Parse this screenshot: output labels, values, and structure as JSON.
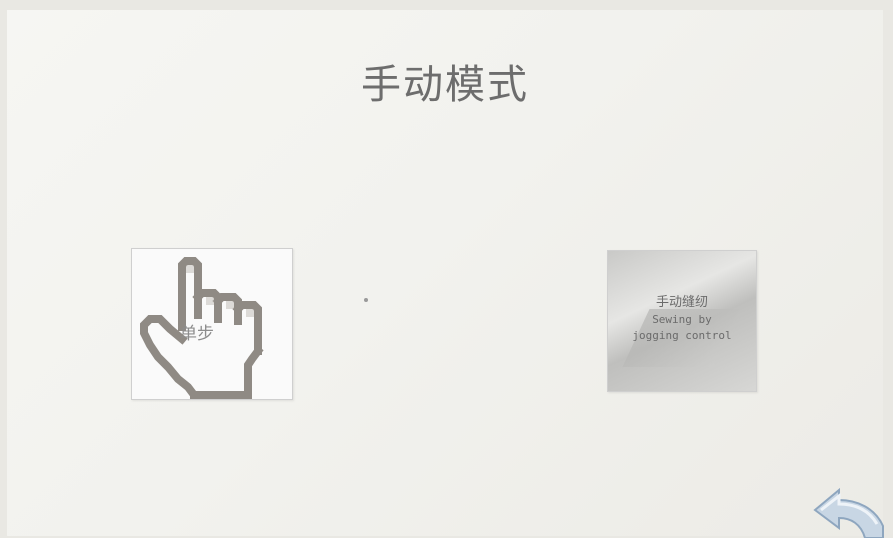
{
  "page": {
    "title": "手动模式"
  },
  "tiles": {
    "step": {
      "label": "单步",
      "icon": "pixel-hand-pointer-icon"
    },
    "jog": {
      "label_cn": "手动缝纫",
      "label_en_line1": "Sewing by",
      "label_en_line2": "jogging control"
    }
  },
  "navigation": {
    "back_icon": "back-arrow-icon"
  },
  "colors": {
    "screen_bg": "#f3f3ef",
    "title_text": "#6d6d6d",
    "hand_outline": "#8f8a84",
    "back_arrow": "#a9bfd6"
  }
}
